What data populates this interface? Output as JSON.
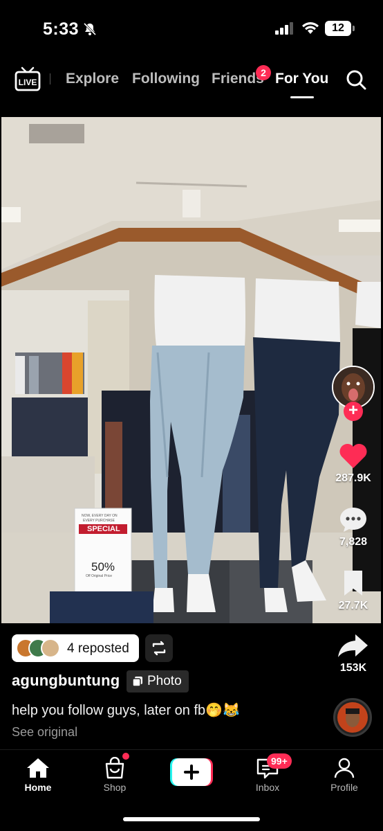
{
  "status_bar": {
    "time": "5:33",
    "battery": "12"
  },
  "top_nav": {
    "tabs": [
      {
        "label": "Explore"
      },
      {
        "label": "Following"
      },
      {
        "label": "Friends",
        "badge": "2"
      },
      {
        "label": "For You",
        "active": true
      }
    ]
  },
  "photo": {
    "sign_line1": "NOW, EVERY DAY ON",
    "sign_line2": "EVERY PURCHASE",
    "sign_banner": "SPECIAL",
    "sign_percent": "50%",
    "sign_small": "Off Original Price"
  },
  "actions": {
    "likes": "287.9K",
    "comments": "7,828",
    "saves": "27.7K",
    "shares": "153K"
  },
  "post": {
    "reposted_label": "4 reposted",
    "username": "agungbuntung",
    "type_tag": "Photo",
    "caption": "help you follow guys, later on fb🤭😹",
    "see_original": "See original"
  },
  "bottom_nav": {
    "items": [
      {
        "label": "Home",
        "active": true
      },
      {
        "label": "Shop"
      },
      {
        "label": "Inbox",
        "badge": "99+"
      },
      {
        "label": "Profile"
      }
    ]
  },
  "colors": {
    "accent": "#fe2c55",
    "background": "#000000"
  }
}
